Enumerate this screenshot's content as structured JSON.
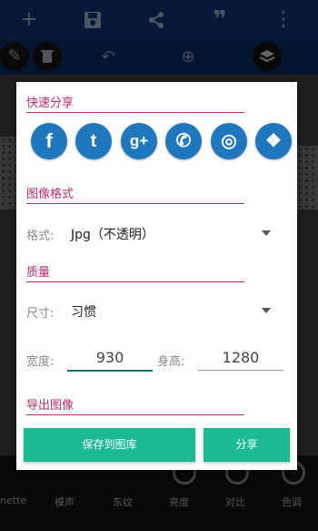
{
  "background": {
    "bottom_tools": [
      {
        "label": "nette"
      },
      {
        "label": "模声"
      },
      {
        "label": "东纹"
      },
      {
        "label": "亮度"
      },
      {
        "label": "对比"
      },
      {
        "label": "色调"
      }
    ]
  },
  "dialog": {
    "quick_share": {
      "title": "快速分享",
      "targets": [
        {
          "name": "facebook",
          "glyph": "f"
        },
        {
          "name": "twitter",
          "glyph": "t"
        },
        {
          "name": "google-plus",
          "glyph": "g+"
        },
        {
          "name": "whatsapp",
          "glyph": "✆"
        },
        {
          "name": "instagram",
          "glyph": "◎"
        },
        {
          "name": "dropbox",
          "glyph": "❖"
        }
      ]
    },
    "image_format": {
      "title": "图像格式",
      "format_label": "格式:",
      "format_value": "Jpg（不透明）"
    },
    "quality": {
      "title": "质量",
      "size_label": "尺寸:",
      "size_value": "习惯",
      "width_label": "宽度:",
      "width_value": "930",
      "height_label": "身高:",
      "height_value": "1280"
    },
    "export": {
      "title": "导出图像",
      "save_button": "保存到图库",
      "share_button": "分享"
    }
  },
  "colors": {
    "accent": "#b62e6e",
    "share_blue": "#1f77bd",
    "button_green": "#1aba93",
    "topbar": "#0d2c66"
  }
}
